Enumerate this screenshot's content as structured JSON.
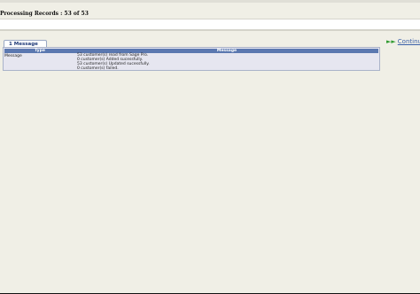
{
  "header": {
    "title": "Processing Records : 53 of 53"
  },
  "tab": {
    "label": "1 Message"
  },
  "table": {
    "columns": [
      "Type",
      "Message"
    ],
    "rows": [
      {
        "type": "Message",
        "lines": [
          "53 customer(s) read from Sage Pro.",
          "0 customer(s) Added sucessfully.",
          "53 customer(s) Updated sucessfully.",
          "0 customer(s) failed."
        ]
      }
    ]
  },
  "actions": {
    "continue_label": "Continue",
    "continue_icon": "double-arrow-right-icon"
  }
}
